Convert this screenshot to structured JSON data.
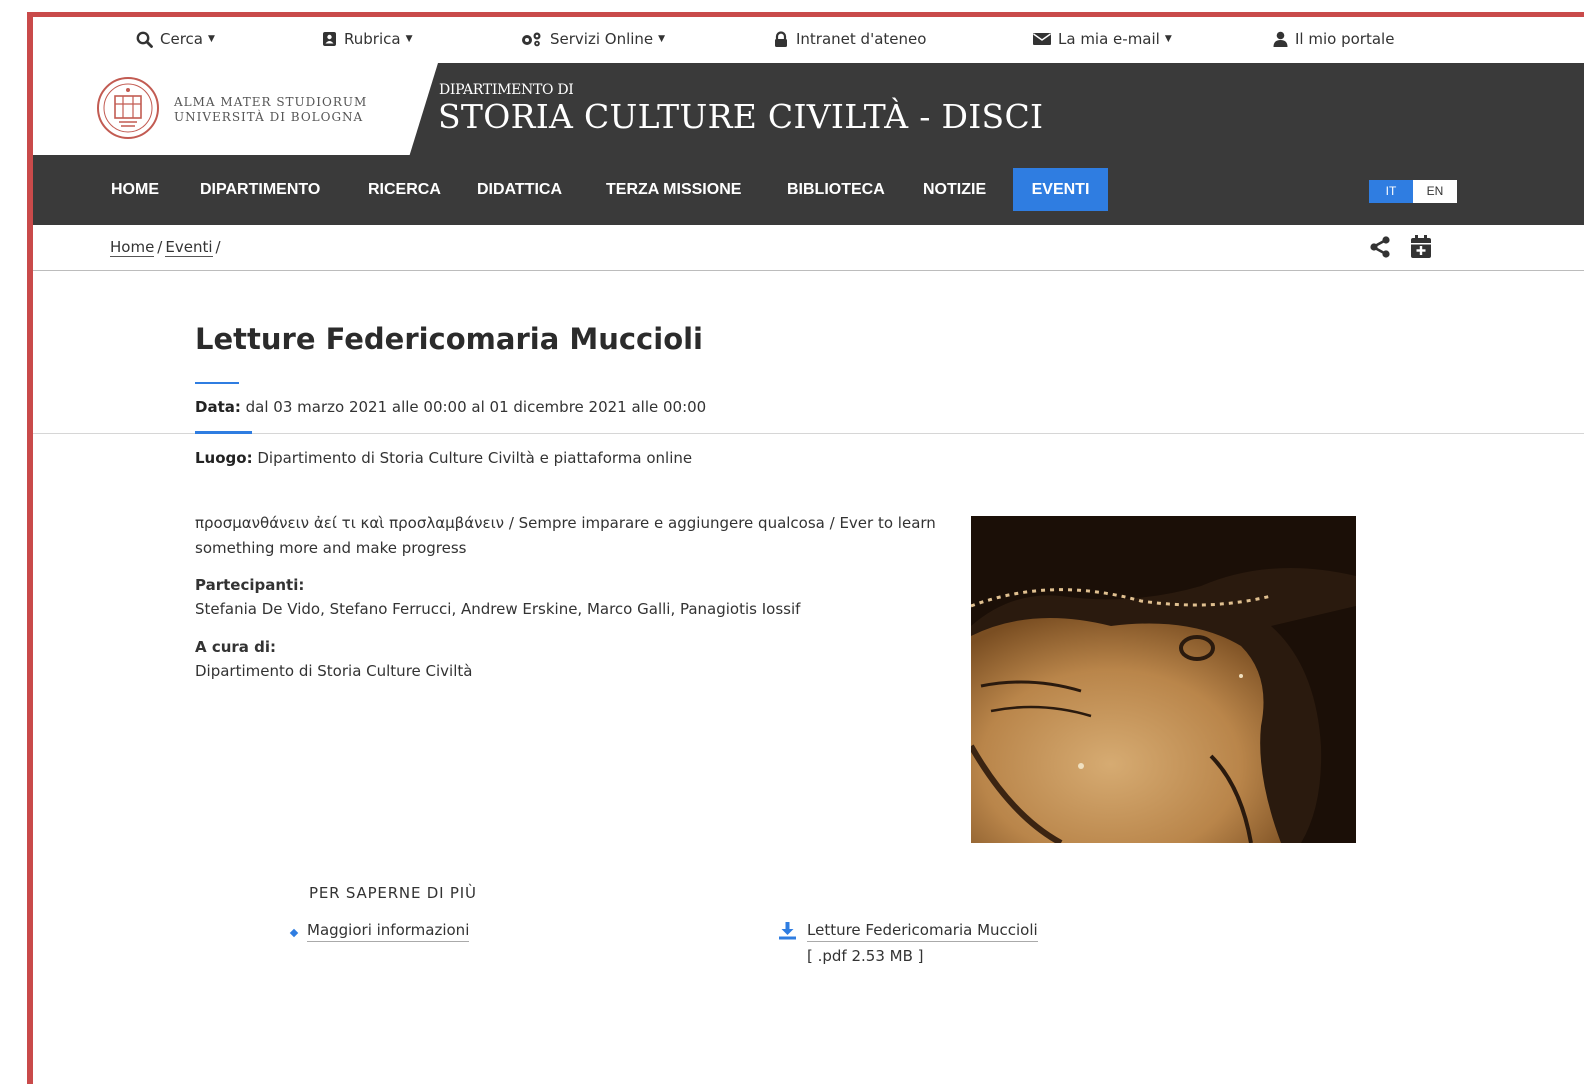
{
  "utility_bar": {
    "search": "Cerca",
    "directory": "Rubrica",
    "online_services": "Servizi Online",
    "intranet": "Intranet d'ateneo",
    "email": "La mia e-mail",
    "portal": "Il mio portale"
  },
  "header": {
    "university_line1": "ALMA MATER STUDIORUM",
    "university_line2": "UNIVERSITÀ DI BOLOGNA",
    "dept_prefix": "DIPARTIMENTO DI",
    "dept_name": "STORIA CULTURE CIVILTÀ - DISCI"
  },
  "nav": {
    "items": [
      {
        "label": "HOME"
      },
      {
        "label": "DIPARTIMENTO"
      },
      {
        "label": "RICERCA"
      },
      {
        "label": "DIDATTICA"
      },
      {
        "label": "TERZA MISSIONE"
      },
      {
        "label": "BIBLIOTECA"
      },
      {
        "label": "NOTIZIE"
      },
      {
        "label": "EVENTI",
        "active": true
      }
    ],
    "lang_it": "IT",
    "lang_en": "EN"
  },
  "breadcrumb": {
    "home": "Home",
    "events": "Eventi",
    "separator": "/"
  },
  "event": {
    "title": "Letture Federicomaria Muccioli",
    "date_label": "Data:",
    "date_value": "dal 03 marzo 2021 alle 00:00 al 01 dicembre 2021 alle 00:00",
    "place_label": "Luogo:",
    "place_value": "Dipartimento di Storia Culture Civiltà e piattaforma online",
    "description": "προσμανθάνειν ἀεί τι καὶ προσλαμβάνειν / Sempre imparare e aggiungere qualcosa / Ever to learn something more and make progress",
    "participants_label": "Partecipanti:",
    "participants_value": "Stefania De Vido, Stefano Ferrucci, Andrew Erskine, Marco Galli, Panagiotis Iossif",
    "curated_label": "A cura di:",
    "curated_value": "Dipartimento di Storia Culture Civiltà"
  },
  "more_info": {
    "heading": "PER SAPERNE DI PIÙ",
    "link_label": "Maggiori informazioni",
    "download_label": "Letture Federicomaria Muccioli",
    "download_meta": "[ .pdf 2.53 MB ]"
  },
  "colors": {
    "accent": "#2f7de1",
    "header_bg": "#3a3a3a",
    "frame": "#c94a4a"
  }
}
